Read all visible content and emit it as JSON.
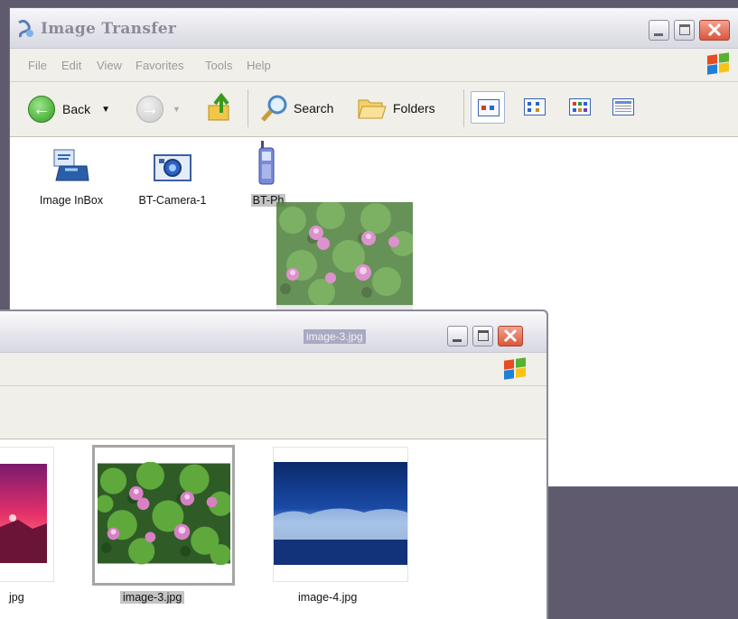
{
  "main_window": {
    "title": "Image Transfer",
    "menu": [
      "File",
      "Edit",
      "View",
      "Favorites",
      "Tools",
      "Help"
    ],
    "toolbar": {
      "back_label": "Back",
      "search_label": "Search",
      "folders_label": "Folders"
    },
    "devices": [
      {
        "label": "Image InBox",
        "icon": "inbox-icon"
      },
      {
        "label": "BT-Camera-1",
        "icon": "camera-icon"
      },
      {
        "label": "BT-Ph",
        "icon": "phone-icon"
      }
    ],
    "drag_ghost_label": "image-3.jpg"
  },
  "second_window": {
    "thumbnails": [
      {
        "label": "jpg",
        "selected": false
      },
      {
        "label": "image-3.jpg",
        "selected": true
      },
      {
        "label": "image-4.jpg",
        "selected": false
      }
    ]
  },
  "colors": {
    "desktop": "#5f5a6e",
    "selection": "#c4c4c4",
    "close_button": "#d9573c"
  }
}
